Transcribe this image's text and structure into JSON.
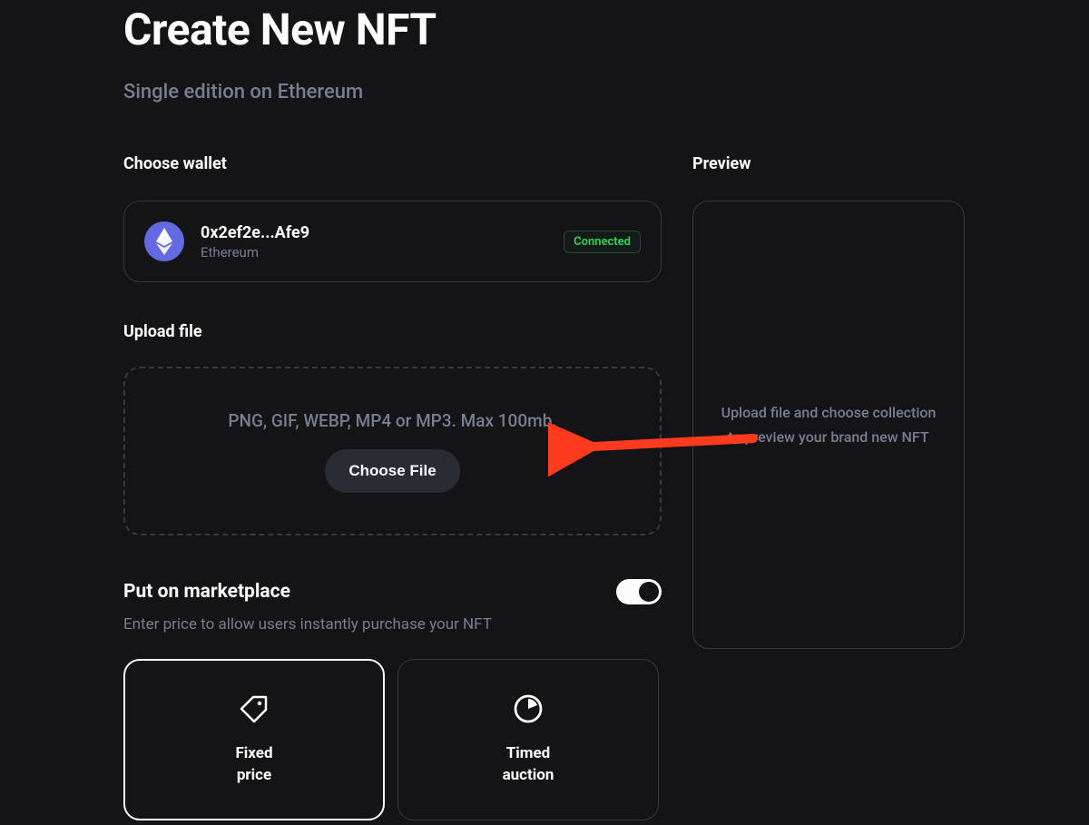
{
  "page": {
    "title": "Create New NFT",
    "subtitle": "Single edition on Ethereum"
  },
  "wallet": {
    "section_label": "Choose wallet",
    "address": "0x2ef2e...Afe9",
    "network": "Ethereum",
    "status_label": "Connected",
    "icon_name": "ethereum-icon"
  },
  "upload": {
    "section_label": "Upload file",
    "hint": "PNG, GIF, WEBP, MP4 or MP3. Max 100mb.",
    "button_label": "Choose File"
  },
  "marketplace": {
    "title": "Put on marketplace",
    "description": "Enter price to allow users instantly purchase your NFT",
    "toggle_on": true,
    "options": [
      {
        "id": "fixed",
        "label": "Fixed\nprice",
        "icon": "price-tag-icon",
        "selected": true
      },
      {
        "id": "timed",
        "label": "Timed\nauction",
        "icon": "clock-icon",
        "selected": false
      }
    ]
  },
  "preview": {
    "section_label": "Preview",
    "placeholder_text": "Upload file and choose collection to preview your brand new NFT"
  },
  "colors": {
    "bg": "#141416",
    "text": "#fcfcfd",
    "muted": "#777e90",
    "border": "#353945",
    "accent_eth": "#6269e1",
    "success": "#2dd754",
    "annotation_arrow": "#ff3b1f"
  }
}
